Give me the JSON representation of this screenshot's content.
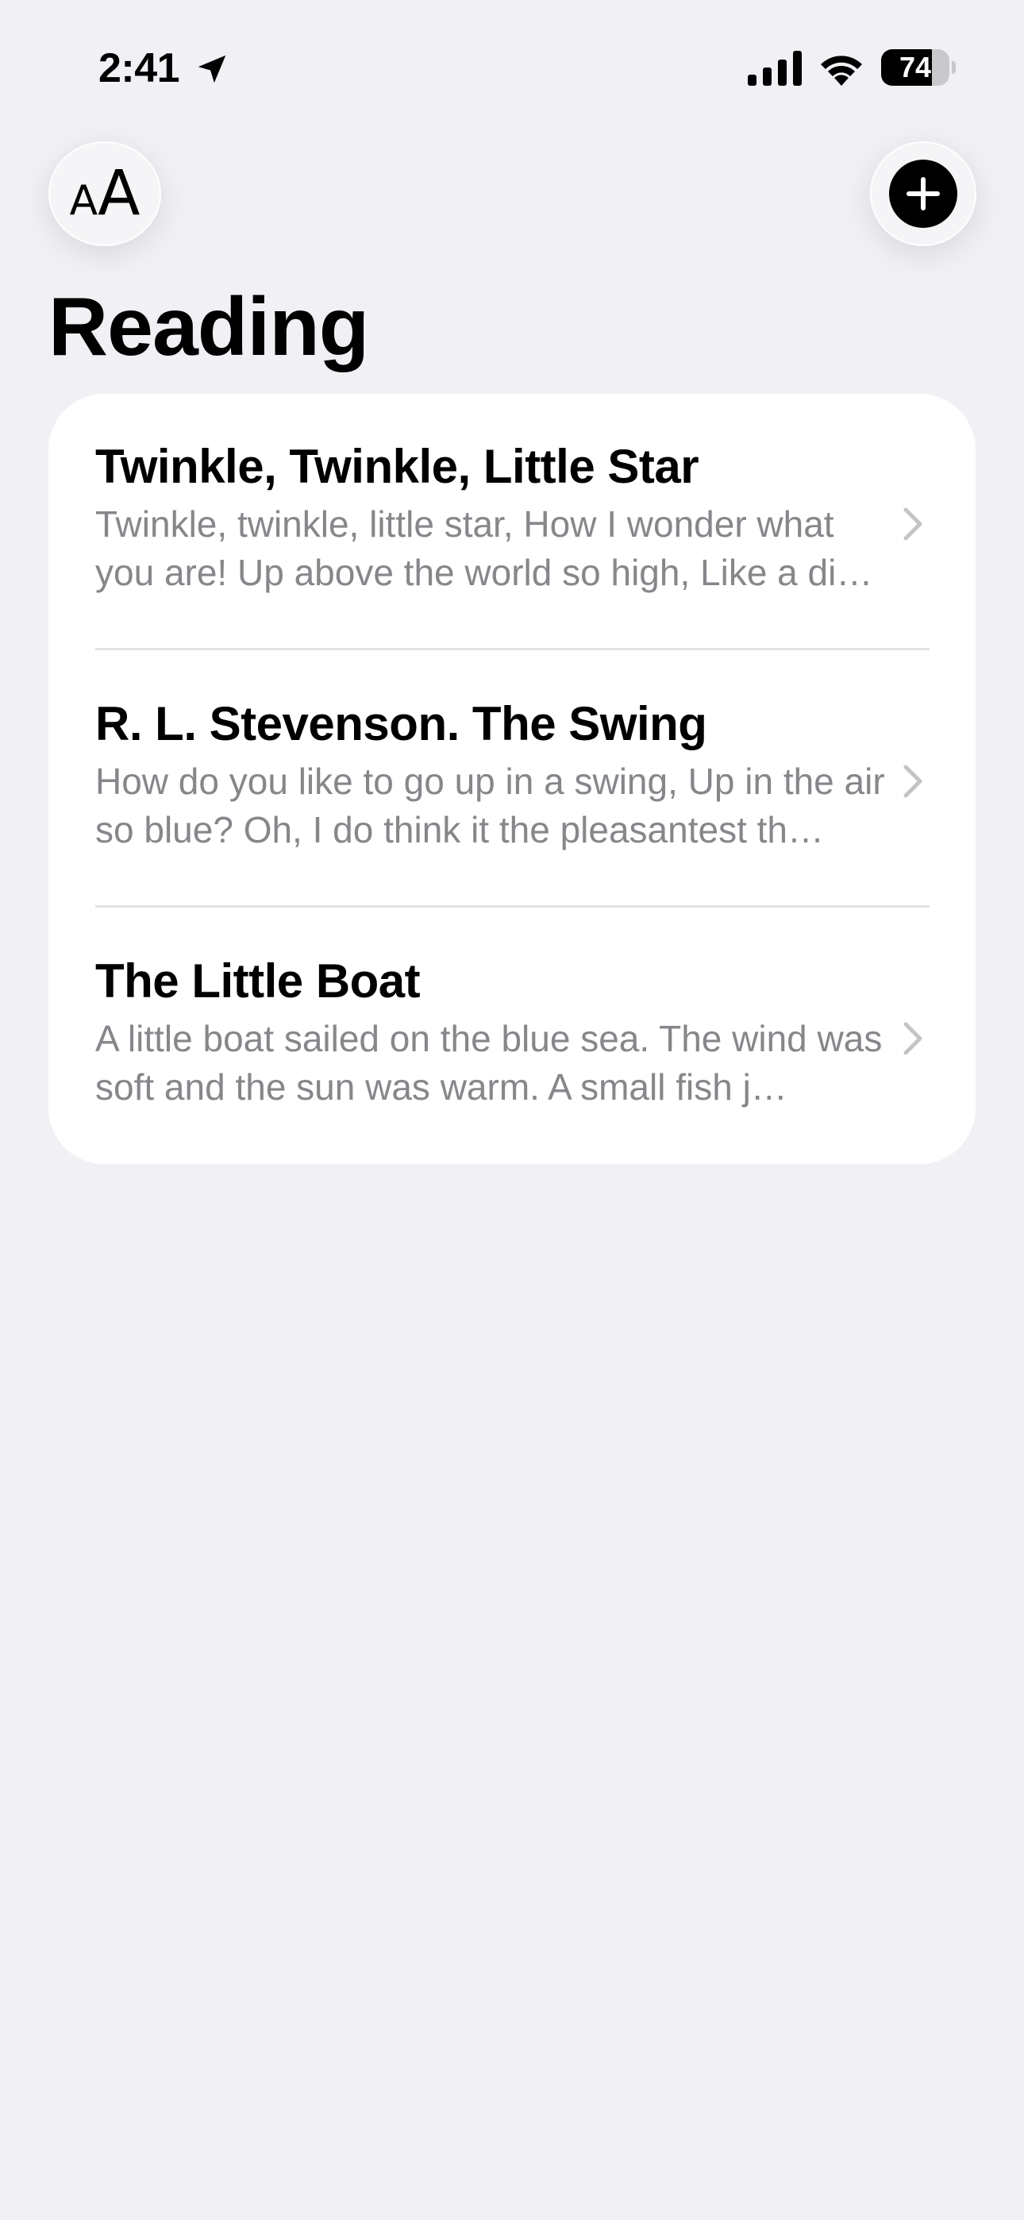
{
  "status_bar": {
    "time": "2:41",
    "battery_level": "74",
    "battery_fraction": 0.74,
    "icons": [
      "location-arrow-icon",
      "cellular-signal-icon",
      "wifi-icon",
      "battery-icon"
    ]
  },
  "toolbar": {
    "text_size_icon": "text-size-icon",
    "text_size_small": "A",
    "text_size_large": "A",
    "add_icon": "plus-circle-icon"
  },
  "page": {
    "title": "Reading"
  },
  "readings": [
    {
      "title": "Twinkle, Twinkle, Little Star",
      "preview": "Twinkle, twinkle, little star, How I wonder what you are! Up above the world so high, Like a di…"
    },
    {
      "title": "R. L. Stevenson. The Swing",
      "preview": "How do you like to go up in a swing, Up in the air so blue? Oh, I do think it the pleasantest th…"
    },
    {
      "title": "The Little Boat",
      "preview": "A little boat sailed on the blue sea. The wind was soft and the sun was warm. A small fish j…"
    }
  ],
  "colors": {
    "background": "#f1f0f5",
    "card": "#ffffff",
    "primary_text": "#000000",
    "secondary_text": "#86868b",
    "chevron": "#c4c4c7",
    "divider": "#e3e3e6"
  }
}
